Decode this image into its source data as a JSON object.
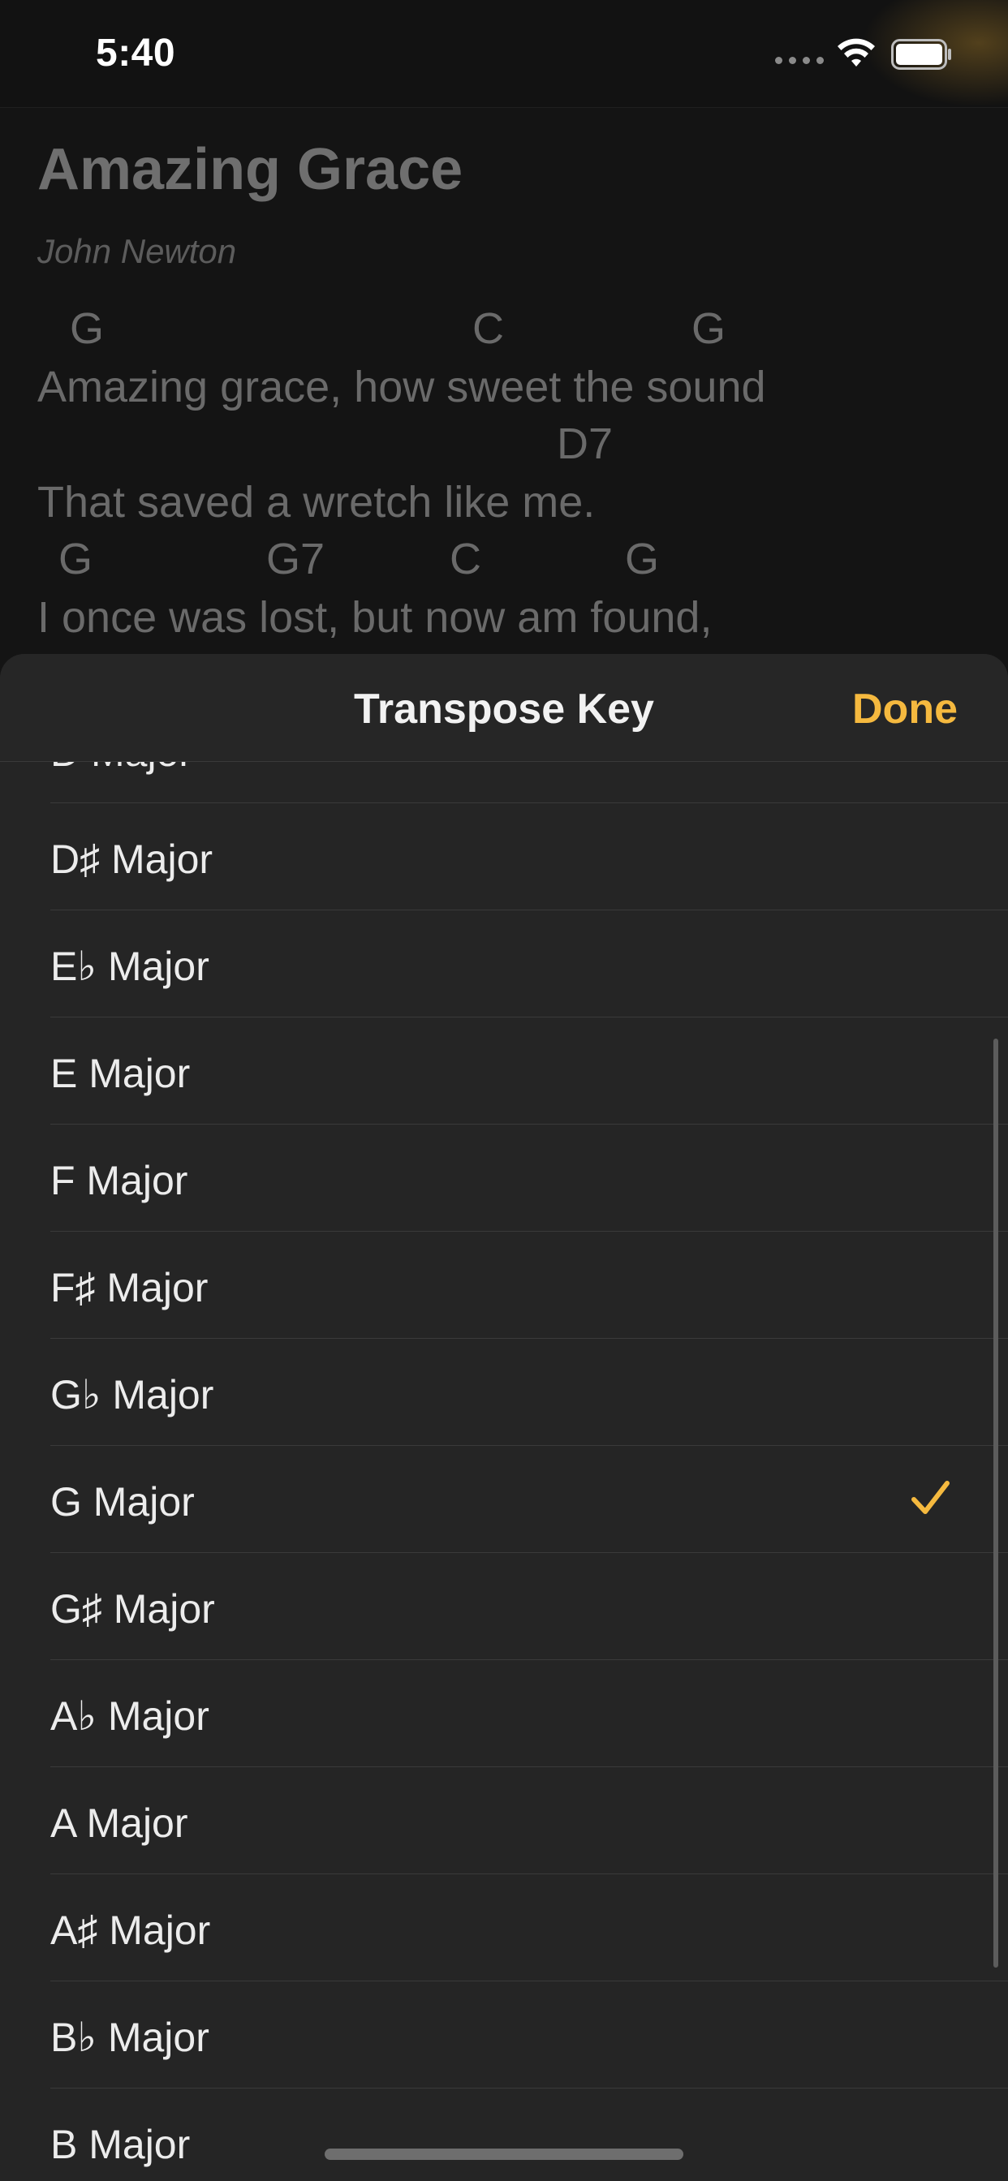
{
  "status_bar": {
    "time": "5:40"
  },
  "song": {
    "title": "Amazing Grace",
    "author": "John Newton",
    "lines": [
      {
        "chords": [
          "G",
          "C",
          "G"
        ],
        "lyric": "Amazing grace, how sweet the sound"
      },
      {
        "chords": [
          "D7"
        ],
        "lyric": "That saved a wretch like me."
      },
      {
        "chords": [
          "G",
          "G7",
          "C",
          "G"
        ],
        "lyric": "I once was lost, but now am found,"
      }
    ]
  },
  "sheet": {
    "title": "Transpose Key",
    "done_label": "Done",
    "selected_key": "G Major",
    "keys": [
      "D Major",
      "D♯ Major",
      "E♭ Major",
      "E Major",
      "F Major",
      "F♯ Major",
      "G♭ Major",
      "G Major",
      "G♯ Major",
      "A♭ Major",
      "A Major",
      "A♯ Major",
      "B♭ Major",
      "B Major"
    ]
  },
  "colors": {
    "accent": "#f5b93f",
    "sheet_background": "#252525",
    "separator": "#3a3a3a"
  }
}
